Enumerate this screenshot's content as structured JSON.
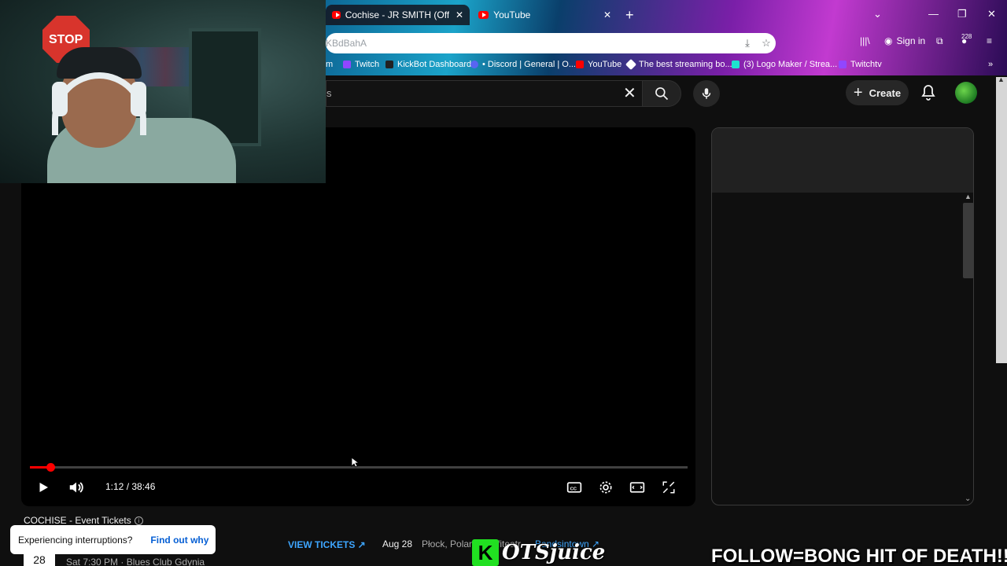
{
  "browser": {
    "tabs": [
      {
        "title": "Cochise - JR SMITH (Official Mu",
        "active": true
      },
      {
        "title": "YouTube",
        "active": false
      }
    ],
    "url": "KBdBahA",
    "signin_label": "Sign in",
    "notification_count": "228",
    "bookmarks": [
      {
        "label": "m",
        "color": "#9146ff"
      },
      {
        "label": "Twitch",
        "color": "#9146ff"
      },
      {
        "label": "KickBot Dashboard",
        "color": "#222222"
      },
      {
        "label": "• Discord | General | O...",
        "color": "#5865f2"
      },
      {
        "label": "YouTube",
        "color": "#ff0000"
      },
      {
        "label": "The best streaming bo...",
        "color": "#ffffff"
      },
      {
        "label": "(3) Logo Maker / Strea...",
        "color": "#1ee3cf"
      },
      {
        "label": "Twitchtv",
        "color": "#9146ff"
      }
    ]
  },
  "youtube": {
    "search_query": "s",
    "create_label": "Create",
    "player": {
      "current_time": "1:12",
      "duration": "38:46",
      "time_display": "1:12 / 38:46",
      "progress_fraction": 0.031
    },
    "tickets": {
      "title": "COCHISE - Event Tickets",
      "info_icon": "ⓘ",
      "view_tickets_label": "VIEW TICKETS ↗",
      "event1": {
        "day": "28",
        "detail": "Sat 7:30 PM · Blues Club Gdynia"
      },
      "event2": {
        "date": "Aug 28",
        "location": "Płock, Polan",
        "venue": "fiteatr",
        "source": "Bandsintown ↗"
      }
    },
    "interrupt": {
      "text": "Experiencing interruptions?",
      "link": "Find out why"
    }
  },
  "overlay": {
    "webcam_sign": "STOP",
    "brand_k": "K",
    "brand_name": "OTSjuice",
    "follow_text": "FOLLOW=BONG HIT OF DEATH!!!"
  },
  "colors": {
    "accent_red": "#ff0000",
    "link_blue": "#3ea6ff",
    "brand_green": "#21e021"
  }
}
